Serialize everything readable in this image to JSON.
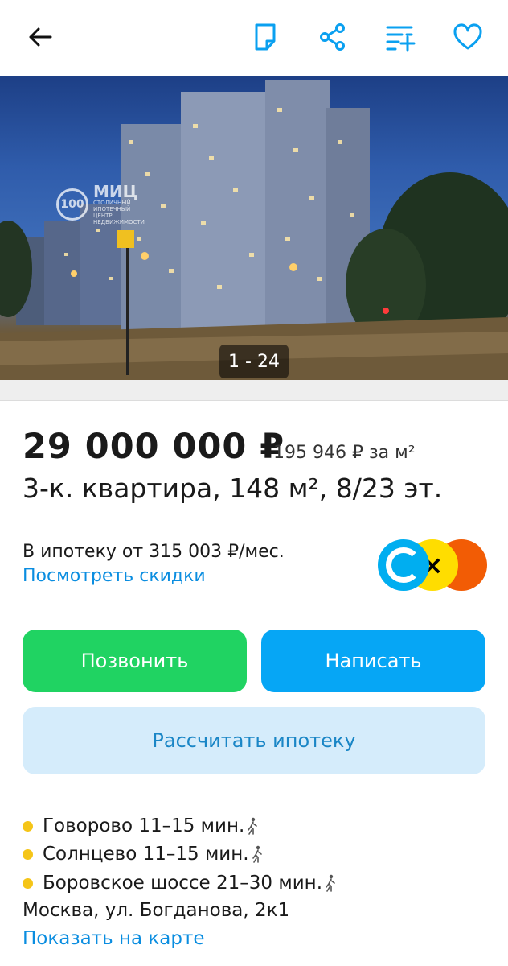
{
  "header": {
    "icons": [
      "back-arrow-icon",
      "note-icon",
      "share-icon",
      "compare-icon",
      "heart-icon"
    ]
  },
  "gallery": {
    "counter": "1 - 24",
    "watermark_logo": "МИЦ",
    "watermark_sub": "СТОЛИЧНЫЙ ИПОТЕЧНЫЙ ЦЕНТР НЕДВИЖИМОСТИ"
  },
  "listing": {
    "price": "29 000 000 ₽",
    "price_per_m2": "195 946 ₽ за м²",
    "title": "3-к. квартира, 148 м², 8/23 эт."
  },
  "mortgage": {
    "text": "В ипотеку от 315 003 ₽/мес.",
    "link": "Посмотреть скидки",
    "bank_colors": [
      "#00aef0",
      "#ffdd00",
      "#f25c05"
    ]
  },
  "actions": {
    "call": "Позвонить",
    "write": "Написать",
    "calculate": "Рассчитать ипотеку"
  },
  "location": {
    "metro": [
      {
        "name": "Говорово 11–15 мин."
      },
      {
        "name": "Солнцево 11–15 мин."
      },
      {
        "name": "Боровское шоссе 21–30 мин."
      }
    ],
    "metro_line_color": "#f5c518",
    "address": "Москва, ул. Богданова, 2к1",
    "map_link": "Показать на карте"
  }
}
